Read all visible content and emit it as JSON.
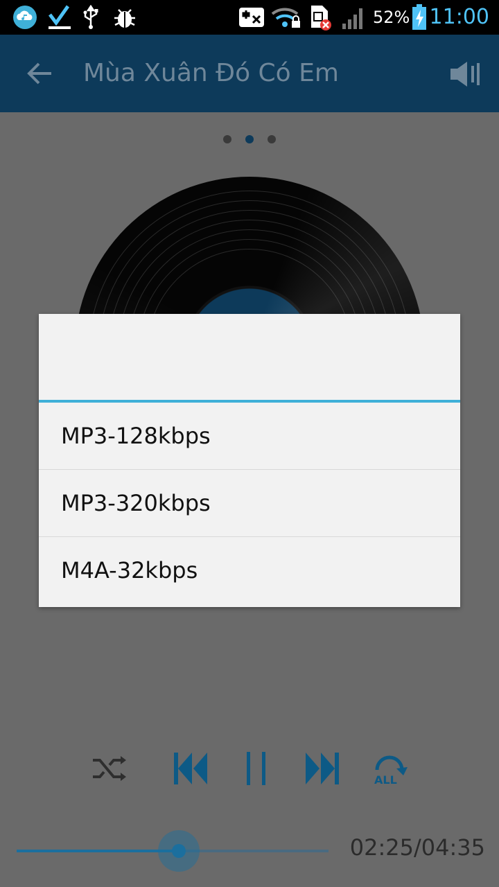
{
  "status_bar": {
    "battery_percent": "52%",
    "time": "11:00",
    "icons": [
      "music-cloud-icon",
      "download-complete-icon",
      "usb-icon",
      "bug-icon",
      "no-sim-icon",
      "wifi-lock-icon",
      "sim-error-icon",
      "signal-icon",
      "battery-charging-icon"
    ]
  },
  "app_bar": {
    "title": "Mùa Xuân Đó Có Em",
    "back_icon": "back-arrow-icon",
    "volume_icon": "volume-icon"
  },
  "pager": {
    "count": 3,
    "active_index": 1
  },
  "dialog": {
    "options": [
      {
        "label": "MP3-128kbps"
      },
      {
        "label": "MP3-320kbps"
      },
      {
        "label": "M4A-32kbps"
      }
    ]
  },
  "player": {
    "controls": [
      "shuffle-icon",
      "previous-icon",
      "pause-icon",
      "next-icon",
      "repeat-all-icon"
    ],
    "repeat_label": "ALL",
    "progress_fraction": 0.52,
    "time_display": "02:25/04:35"
  },
  "colors": {
    "accent": "#3fb0d8",
    "app_bar": "#0d3a5a",
    "control_blue": "#0d5a86",
    "status_time": "#4fc3f7"
  }
}
